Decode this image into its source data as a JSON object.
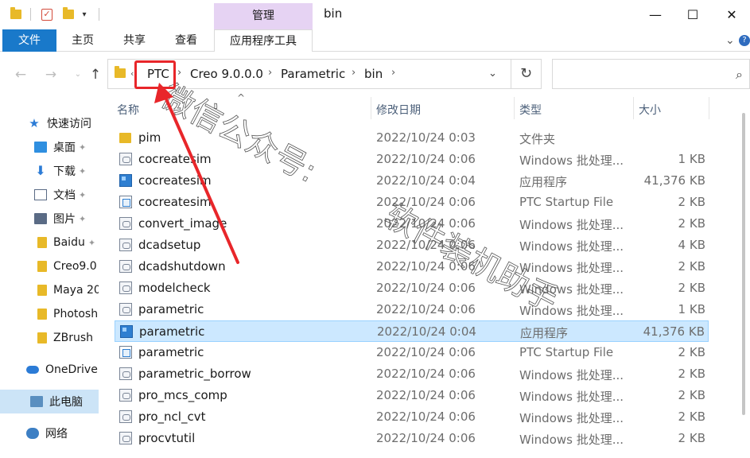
{
  "window": {
    "title": "bin",
    "management_tab": "管理",
    "minimize": "—",
    "maximize": "☐",
    "close": "✕"
  },
  "ribbon": {
    "tabs": [
      "文件",
      "主页",
      "共享",
      "查看",
      "应用程序工具"
    ],
    "collapse_icon": "chevron-down-icon",
    "help_icon": "help-icon"
  },
  "address": {
    "crumbs": [
      "PTC",
      "Creo 9.0.0.0",
      "Parametric",
      "bin"
    ],
    "search_placeholder": ""
  },
  "sidebar": {
    "items": [
      {
        "label": "快速访问",
        "icon": "star-icon",
        "pinned": false
      },
      {
        "label": "桌面",
        "icon": "desktop-icon",
        "pinned": true
      },
      {
        "label": "下载",
        "icon": "download-icon",
        "pinned": true
      },
      {
        "label": "文档",
        "icon": "document-icon",
        "pinned": true
      },
      {
        "label": "图片",
        "icon": "picture-icon",
        "pinned": true
      },
      {
        "label": "Baidu",
        "icon": "folder-icon",
        "pinned": true
      },
      {
        "label": "Creo9.0",
        "icon": "folder-icon",
        "pinned": false
      },
      {
        "label": "Maya 20",
        "icon": "folder-icon",
        "pinned": false
      },
      {
        "label": "Photosh",
        "icon": "folder-icon",
        "pinned": false
      },
      {
        "label": "ZBrush",
        "icon": "folder-icon",
        "pinned": false
      },
      {
        "label": "OneDrive",
        "icon": "onedrive-icon",
        "pinned": false
      },
      {
        "label": "此电脑",
        "icon": "this-pc-icon",
        "pinned": false
      },
      {
        "label": "网络",
        "icon": "network-icon",
        "pinned": false
      }
    ]
  },
  "columns": {
    "name": "名称",
    "date": "修改日期",
    "type": "类型",
    "size": "大小"
  },
  "files": [
    {
      "name": "pim",
      "date": "2022/10/24 0:03",
      "type": "文件夹",
      "size": "",
      "icon": "folder"
    },
    {
      "name": "cocreatesim",
      "date": "2022/10/24 0:06",
      "type": "Windows 批处理...",
      "size": "1 KB",
      "icon": "bat"
    },
    {
      "name": "cocreatesim",
      "date": "2022/10/24 0:04",
      "type": "应用程序",
      "size": "41,376 KB",
      "icon": "exe"
    },
    {
      "name": "cocreatesim",
      "date": "2022/10/24 0:06",
      "type": "PTC Startup File",
      "size": "2 KB",
      "icon": "psf"
    },
    {
      "name": "convert_image",
      "date": "2022/10/24 0:06",
      "type": "Windows 批处理...",
      "size": "2 KB",
      "icon": "bat"
    },
    {
      "name": "dcadsetup",
      "date": "2022/10/24 0:06",
      "type": "Windows 批处理...",
      "size": "4 KB",
      "icon": "bat"
    },
    {
      "name": "dcadshutdown",
      "date": "2022/10/24 0:06",
      "type": "Windows 批处理...",
      "size": "2 KB",
      "icon": "bat"
    },
    {
      "name": "modelcheck",
      "date": "2022/10/24 0:06",
      "type": "Windows 批处理...",
      "size": "2 KB",
      "icon": "bat"
    },
    {
      "name": "parametric",
      "date": "2022/10/24 0:06",
      "type": "Windows 批处理...",
      "size": "1 KB",
      "icon": "bat"
    },
    {
      "name": "parametric",
      "date": "2022/10/24 0:04",
      "type": "应用程序",
      "size": "41,376 KB",
      "icon": "exe",
      "selected": true
    },
    {
      "name": "parametric",
      "date": "2022/10/24 0:06",
      "type": "PTC Startup File",
      "size": "2 KB",
      "icon": "psf"
    },
    {
      "name": "parametric_borrow",
      "date": "2022/10/24 0:06",
      "type": "Windows 批处理...",
      "size": "2 KB",
      "icon": "bat"
    },
    {
      "name": "pro_mcs_comp",
      "date": "2022/10/24 0:06",
      "type": "Windows 批处理...",
      "size": "2 KB",
      "icon": "bat"
    },
    {
      "name": "pro_ncl_cvt",
      "date": "2022/10/24 0:06",
      "type": "Windows 批处理...",
      "size": "2 KB",
      "icon": "bat"
    },
    {
      "name": "procvtutil",
      "date": "2022/10/24 0:06",
      "type": "Windows 批处理...",
      "size": "2 KB",
      "icon": "bat"
    }
  ],
  "watermark": {
    "line1": "微信公众号:",
    "line2": "软件装机助手"
  },
  "colors": {
    "file_tab": "#1979ca",
    "management_tab": "#e6d3f3",
    "selection": "#cce8ff",
    "annotation_red": "#e8262a"
  }
}
